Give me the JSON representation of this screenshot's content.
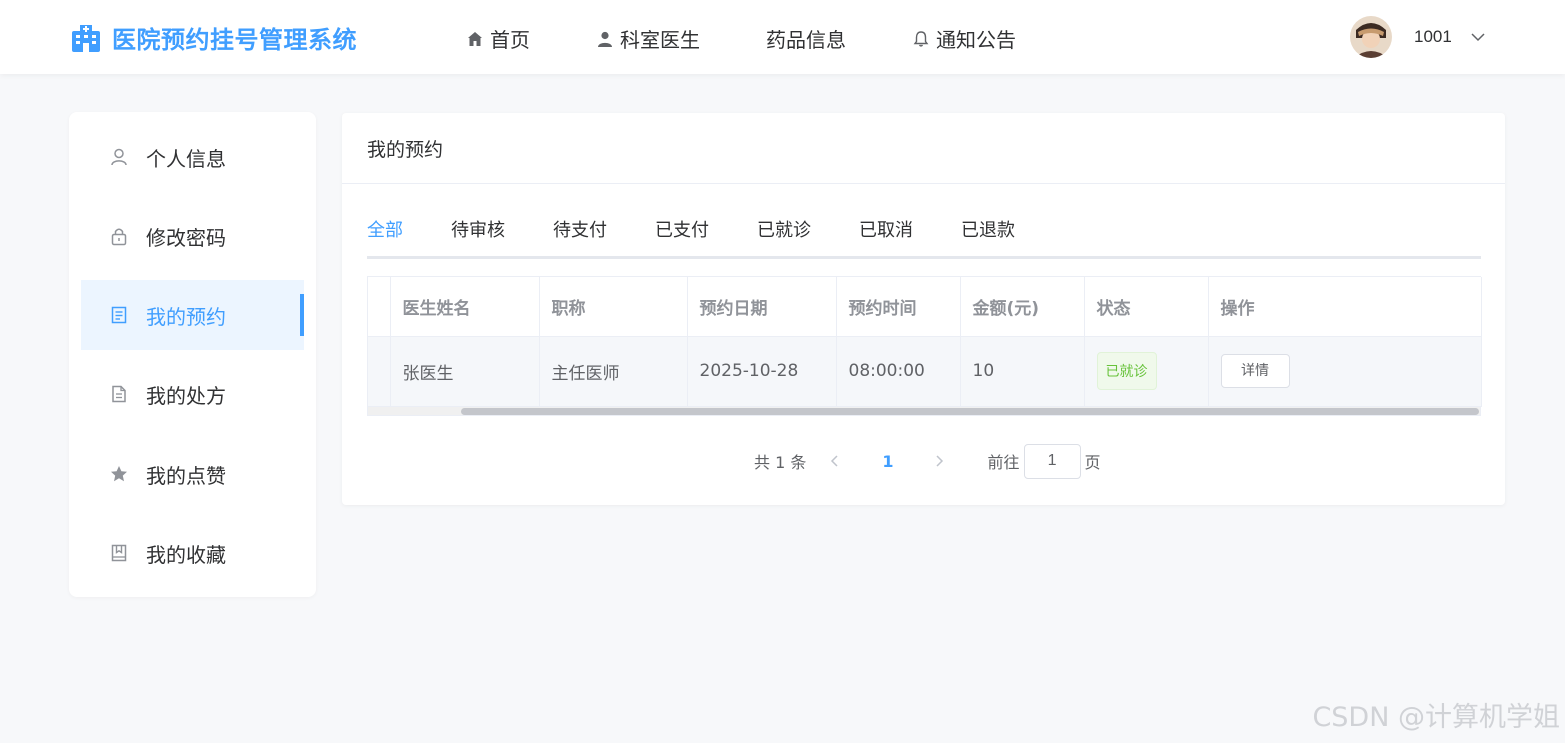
{
  "header": {
    "title": "医院预约挂号管理系统",
    "nav": [
      {
        "label": "首页",
        "icon": "home-icon"
      },
      {
        "label": "科室医生",
        "icon": "user-icon"
      },
      {
        "label": "药品信息",
        "icon": ""
      },
      {
        "label": "通知公告",
        "icon": "bell-icon"
      }
    ],
    "user_name": "1001"
  },
  "sidebar": {
    "items": [
      {
        "label": "个人信息",
        "icon": "person-icon"
      },
      {
        "label": "修改密码",
        "icon": "lock-icon"
      },
      {
        "label": "我的预约",
        "icon": "document-list-icon",
        "active": true
      },
      {
        "label": "我的处方",
        "icon": "file-icon"
      },
      {
        "label": "我的点赞",
        "icon": "star-icon"
      },
      {
        "label": "我的收藏",
        "icon": "bookmark-icon"
      }
    ]
  },
  "main": {
    "title": "我的预约",
    "tabs": [
      "全部",
      "待审核",
      "待支付",
      "已支付",
      "已就诊",
      "已取消",
      "已退款"
    ],
    "active_tab": "全部",
    "table": {
      "columns": [
        "医生姓名",
        "职称",
        "预约日期",
        "预约时间",
        "金额(元)",
        "状态",
        "操作"
      ],
      "rows": [
        {
          "doctor": "张医生",
          "title": "主任医师",
          "date": "2025-10-28",
          "time": "08:00:00",
          "amount": "10",
          "status": "已就诊",
          "action": "详情"
        }
      ]
    },
    "pagination": {
      "total": "共 1 条",
      "current": "1",
      "goto_label": "前往",
      "goto_value": "1",
      "page_suffix": "页"
    }
  },
  "watermark": "CSDN @计算机学姐",
  "colors": {
    "accent": "#409eff",
    "success": "#67c23a",
    "background": "#f7f8fa"
  }
}
